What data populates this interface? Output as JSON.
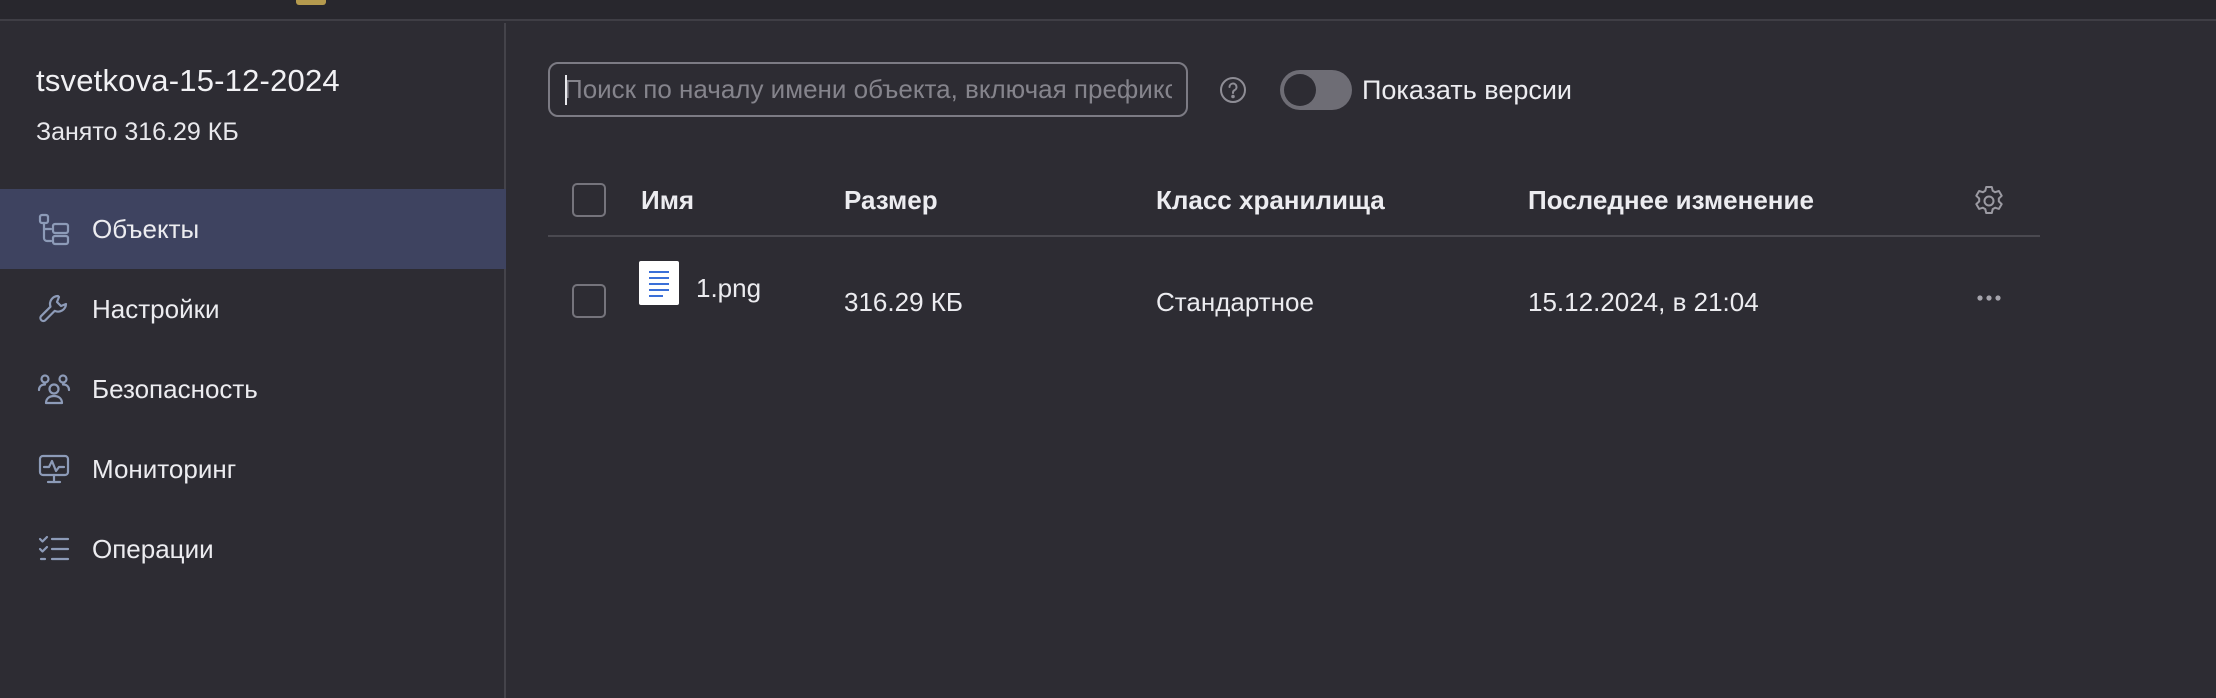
{
  "bucket": {
    "name": "tsvetkova-15-12-2024",
    "usage": "Занято 316.29 КБ"
  },
  "sidebar": {
    "items": [
      {
        "label": "Объекты",
        "icon": "objects-tree-icon",
        "active": true
      },
      {
        "label": "Настройки",
        "icon": "wrench-icon",
        "active": false
      },
      {
        "label": "Безопасность",
        "icon": "users-group-icon",
        "active": false
      },
      {
        "label": "Мониторинг",
        "icon": "monitor-chart-icon",
        "active": false
      },
      {
        "label": "Операции",
        "icon": "checklist-icon",
        "active": false
      }
    ]
  },
  "toolbar": {
    "search_placeholder": "Поиск по началу имени объекта, включая префикс",
    "search_value": "",
    "help_icon": "question-circle-icon",
    "versions_toggle_label": "Показать версии",
    "versions_toggle_on": false
  },
  "table": {
    "columns": {
      "name": "Имя",
      "size": "Размер",
      "storage_class": "Класс хранилища",
      "modified": "Последнее изменение"
    },
    "rows": [
      {
        "name": "1.png",
        "size": "316.29 КБ",
        "storage_class": "Стандартное",
        "modified": "15.12.2024, в 21:04",
        "icon": "file-document-icon"
      }
    ]
  },
  "colors": {
    "background": "#2d2c33",
    "active_nav": "#3e4360",
    "text": "#ececf0",
    "icon": "#8d9bb8"
  }
}
